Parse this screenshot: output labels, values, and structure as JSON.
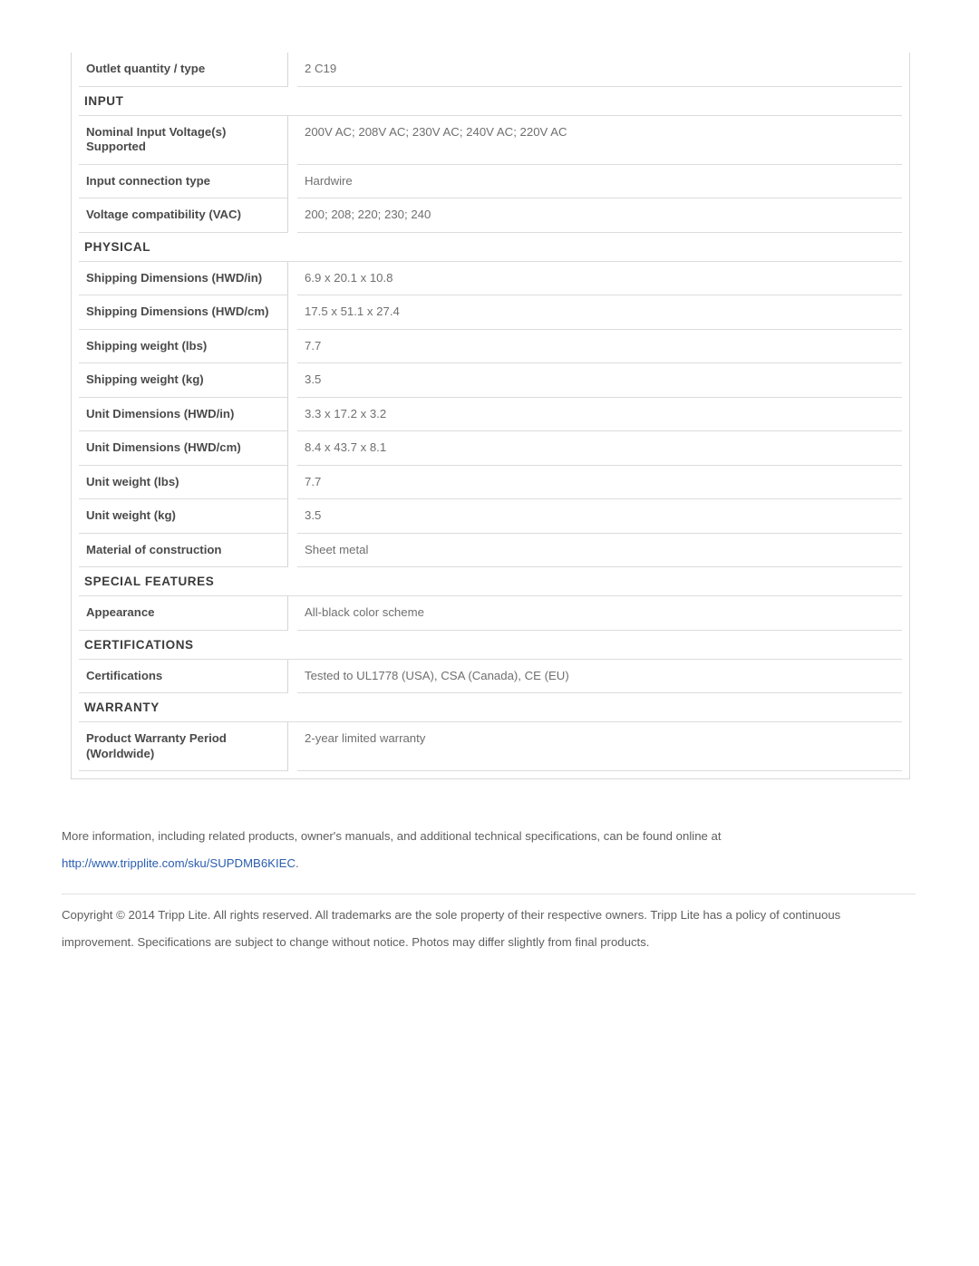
{
  "spec_table": {
    "rows": [
      {
        "kind": "data",
        "label": "Outlet quantity / type",
        "value": "2 C19"
      },
      {
        "kind": "section",
        "label": "INPUT"
      },
      {
        "kind": "data",
        "label": "Nominal Input Voltage(s) Supported",
        "value": "200V AC; 208V AC; 230V AC; 240V AC; 220V AC"
      },
      {
        "kind": "data",
        "label": "Input connection type",
        "value": "Hardwire"
      },
      {
        "kind": "data",
        "label": "Voltage compatibility (VAC)",
        "value": "200; 208; 220; 230; 240"
      },
      {
        "kind": "section",
        "label": "PHYSICAL"
      },
      {
        "kind": "data",
        "label": "Shipping Dimensions (HWD/in)",
        "value": "6.9 x 20.1 x 10.8"
      },
      {
        "kind": "data",
        "label": "Shipping Dimensions (HWD/cm)",
        "value": "17.5 x 51.1 x 27.4"
      },
      {
        "kind": "data",
        "label": "Shipping weight (lbs)",
        "value": "7.7"
      },
      {
        "kind": "data",
        "label": "Shipping weight (kg)",
        "value": "3.5"
      },
      {
        "kind": "data",
        "label": "Unit Dimensions (HWD/in)",
        "value": "3.3 x 17.2 x 3.2"
      },
      {
        "kind": "data",
        "label": "Unit Dimensions (HWD/cm)",
        "value": "8.4 x 43.7 x 8.1"
      },
      {
        "kind": "data",
        "label": "Unit weight (lbs)",
        "value": "7.7"
      },
      {
        "kind": "data",
        "label": "Unit weight (kg)",
        "value": "3.5"
      },
      {
        "kind": "data",
        "label": "Material of construction",
        "value": "Sheet metal"
      },
      {
        "kind": "section",
        "label": "SPECIAL FEATURES"
      },
      {
        "kind": "data",
        "label": "Appearance",
        "value": "All-black color scheme"
      },
      {
        "kind": "section",
        "label": "CERTIFICATIONS"
      },
      {
        "kind": "data",
        "label": "Certifications",
        "value": "Tested to UL1778 (USA), CSA (Canada), CE (EU)"
      },
      {
        "kind": "section",
        "label": "WARRANTY"
      },
      {
        "kind": "data",
        "label": "Product Warranty Period (Worldwide)",
        "value": "2-year limited warranty"
      }
    ]
  },
  "footer": {
    "more_info_text": "More information, including related products, owner's manuals, and additional technical specifications, can be found online at",
    "link_text": "http://www.tripplite.com/sku/SUPDMB6KIEC",
    "link_period": ".",
    "copyright": "Copyright © 2014 Tripp Lite. All rights reserved. All trademarks are the sole property of their respective owners. Tripp Lite has a policy of continuous improvement. Specifications are subject to change without notice. Photos may differ slightly from final products."
  },
  "colors": {
    "link": "#2a5db0",
    "label_text": "#4a4a4a",
    "value_text": "#6f6f6f",
    "section_text": "#3b3b3b",
    "border": "#dcdcdc"
  }
}
